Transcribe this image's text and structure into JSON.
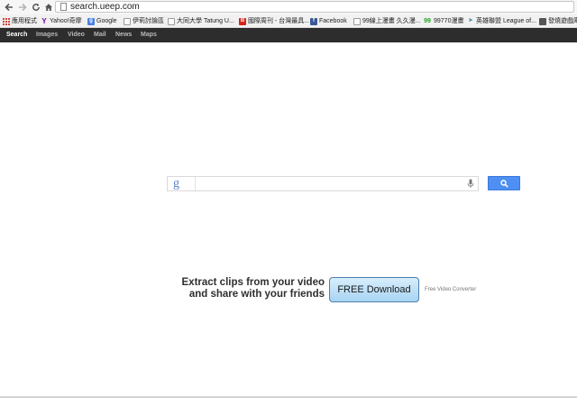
{
  "browser": {
    "url": "search.ueep.com",
    "bookmarks": [
      {
        "icon": "apps-icon",
        "label": "應用程式"
      },
      {
        "icon": "yahoo-icon",
        "label": "Yahoo!奇摩"
      },
      {
        "icon": "google-icon",
        "label": "Google"
      },
      {
        "icon": "forum-icon",
        "label": "伊莉討論區"
      },
      {
        "icon": "page-icon",
        "label": "大同大學 Tatung U..."
      },
      {
        "icon": "b-icon",
        "label": "國際周刊 - 台灣最具..."
      },
      {
        "icon": "facebook-icon",
        "label": "Facebook"
      },
      {
        "icon": "page-icon",
        "label": "99線上漫畫 久久漫..."
      },
      {
        "icon": "99-icon",
        "label": "99770漫畫"
      },
      {
        "icon": "lol-icon",
        "label": "英雄聯盟 League of..."
      },
      {
        "icon": "game-icon",
        "label": "發燒遊戲庫"
      }
    ]
  },
  "site_nav": {
    "links": [
      "Search",
      "Images",
      "Video",
      "Mail",
      "News",
      "Maps"
    ]
  },
  "search": {
    "logo": "g",
    "placeholder": ""
  },
  "ad": {
    "line1": "Extract clips from your video",
    "line2": "and share with your friends",
    "button_label": "FREE Download",
    "caption": "Free Video Converter"
  },
  "colors": {
    "search_button": "#4d8ff2",
    "nav_bar": "#2d2d2d"
  }
}
